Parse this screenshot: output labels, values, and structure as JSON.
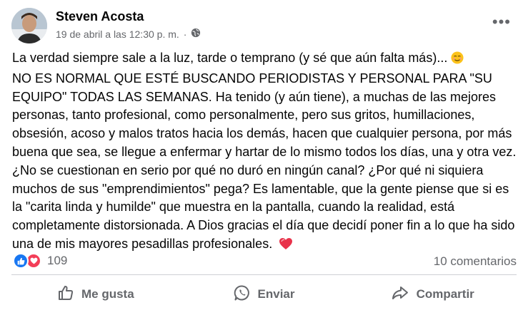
{
  "post": {
    "author": "Steven Acosta",
    "timestamp": "19 de abril a las 12:30 p. m.",
    "separator": "·",
    "privacy_icon": "globe-icon",
    "more_icon": "more-options-icon",
    "more_glyph": "•••",
    "text_line1": "La verdad siempre sale a la luz, tarde o temprano (y sé que aún falta más)...",
    "emoji1": "relieved-face-emoji",
    "text_body": "NO ES NORMAL QUE ESTÉ BUSCANDO PERIODISTAS Y PERSONAL PARA \"SU EQUIPO\" TODAS LAS SEMANAS. Ha tenido (y aún tiene), a muchas de las mejores personas, tanto profesional, como personalmente, pero sus gritos, humillaciones, obsesión, acoso y malos tratos hacia los demás, hacen que cualquier persona, por más buena que sea, se llegue a enfermar y hartar de lo mismo todos los días, una y otra vez. ¿No se cuestionan en serio por qué no duró en ningún canal? ¿Por qué ni siquiera muchos de sus \"emprendimientos\" pega? Es lamentable, que la gente piense que si es la \"carita linda y humilde\" que muestra en la pantalla, cuando la realidad, está completamente distorsionada. A Dios gracias el día que decidí poner fin a lo que ha sido una de mis mayores pesadillas profesionales.",
    "emoji2": "heart-emoji"
  },
  "stats": {
    "reaction_count": "109",
    "comments": "10 comentarios",
    "reaction_types": [
      "like",
      "love"
    ]
  },
  "actions": {
    "like": "Me gusta",
    "share_whatsapp": "Enviar",
    "share": "Compartir"
  },
  "colors": {
    "like_blue": "#1877f2",
    "love_red": "#f33e58",
    "secondary_text": "#65676b"
  }
}
